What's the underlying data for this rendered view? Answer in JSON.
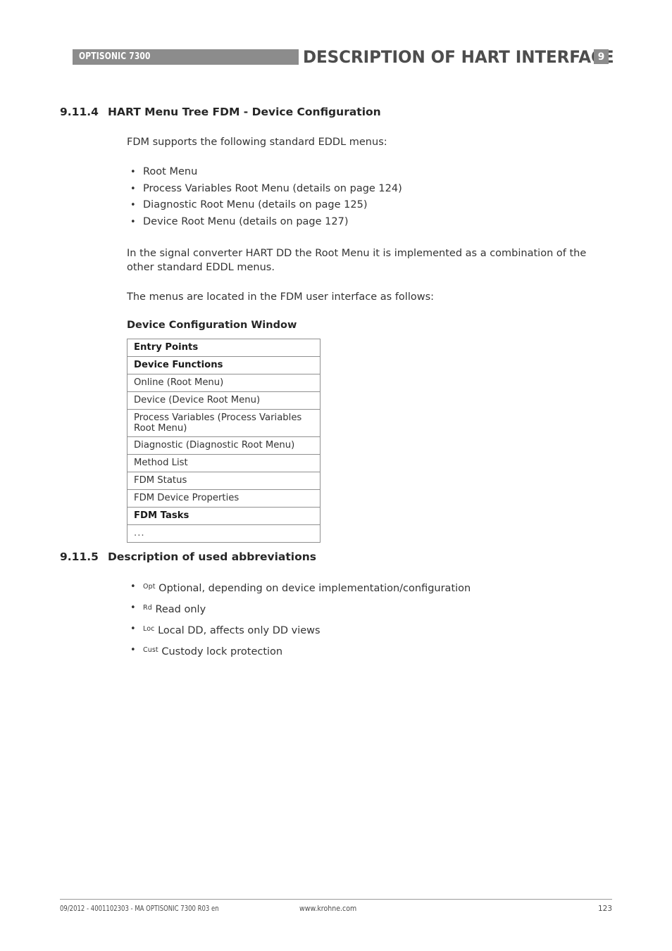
{
  "header": {
    "brand": "OPTISONIC 7300",
    "title": "DESCRIPTION OF HART INTERFACE",
    "chapter_badge": "9",
    "bar_color": "#8c8c8c",
    "title_color": "#4d4d4d"
  },
  "section_1": {
    "number": "9.11.4",
    "title": "HART Menu Tree FDM - Device Configuration",
    "intro": "FDM supports the following standard EDDL menus:",
    "menus": [
      "Root Menu",
      "Process Variables Root Menu (details on page 124)",
      "Diagnostic Root Menu (details on page 125)",
      "Device Root Menu (details on page 127)"
    ],
    "paragraph_combination": "In the signal converter HART DD the Root Menu it is implemented as a combination of the other standard EDDL menus.",
    "paragraph_located": "The menus are located in the FDM user interface as follows:"
  },
  "table": {
    "caption": "Device Configuration Window",
    "rows": [
      {
        "label": "Entry Points",
        "bold": true,
        "two_line": false
      },
      {
        "label": "Device Functions",
        "bold": true,
        "two_line": false
      },
      {
        "label": "Online (Root Menu)",
        "bold": false,
        "two_line": false
      },
      {
        "label": "Device (Device Root Menu)",
        "bold": false,
        "two_line": false
      },
      {
        "label": "Process Variables (Process Variables Root Menu)",
        "bold": false,
        "two_line": true
      },
      {
        "label": "Diagnostic (Diagnostic Root Menu)",
        "bold": false,
        "two_line": false
      },
      {
        "label": "Method List",
        "bold": false,
        "two_line": false
      },
      {
        "label": "FDM Status",
        "bold": false,
        "two_line": false
      },
      {
        "label": "FDM Device Properties",
        "bold": false,
        "two_line": false
      },
      {
        "label": "FDM Tasks",
        "bold": true,
        "two_line": false
      },
      {
        "label": "...",
        "bold": false,
        "two_line": false
      }
    ]
  },
  "section_2": {
    "number": "9.11.5",
    "title": "Description of used abbreviations",
    "abbreviations": [
      {
        "tag": "Opt",
        "text": "Optional, depending on device implementation/configuration"
      },
      {
        "tag": "Rd",
        "text": "Read only"
      },
      {
        "tag": "Loc",
        "text": "Local DD, affects only DD views"
      },
      {
        "tag": "Cust",
        "text": "Custody lock protection"
      }
    ]
  },
  "footer": {
    "left": "09/2012 - 4001102303 - MA OPTISONIC 7300 R03 en",
    "center": "www.krohne.com",
    "page_number": "123"
  }
}
